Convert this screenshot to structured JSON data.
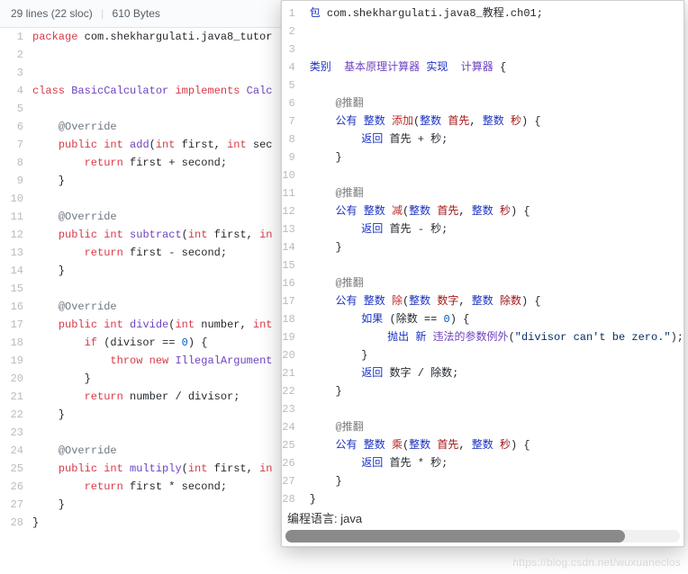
{
  "header": {
    "lines_label": "29 lines (22 sloc)",
    "bytes_label": "610 Bytes"
  },
  "left_code": [
    {
      "n": "1",
      "html": "<span class='kw1'>package</span> com.shekhargulati.java8_tutor"
    },
    {
      "n": "2",
      "html": ""
    },
    {
      "n": "3",
      "html": ""
    },
    {
      "n": "4",
      "html": "<span class='kw1'>class</span> <span class='type'>BasicCalculator</span> <span class='kw1'>implements</span> <span class='type'>Calc</span>"
    },
    {
      "n": "5",
      "html": ""
    },
    {
      "n": "6",
      "html": "    <span class='ovr-left'>@Override</span>"
    },
    {
      "n": "7",
      "html": "    <span class='kw1'>public</span> <span class='kw1'>int</span> <span class='type'>add</span>(<span class='kw1'>int</span> first, <span class='kw1'>int</span> sec"
    },
    {
      "n": "8",
      "html": "        <span class='kw1'>return</span> first + second;"
    },
    {
      "n": "9",
      "html": "    }"
    },
    {
      "n": "10",
      "html": ""
    },
    {
      "n": "11",
      "html": "    <span class='ovr-left'>@Override</span>"
    },
    {
      "n": "12",
      "html": "    <span class='kw1'>public</span> <span class='kw1'>int</span> <span class='type'>subtract</span>(<span class='kw1'>int</span> first, <span class='kw1'>in</span>"
    },
    {
      "n": "13",
      "html": "        <span class='kw1'>return</span> first - second;"
    },
    {
      "n": "14",
      "html": "    }"
    },
    {
      "n": "15",
      "html": ""
    },
    {
      "n": "16",
      "html": "    <span class='ovr-left'>@Override</span>"
    },
    {
      "n": "17",
      "html": "    <span class='kw1'>public</span> <span class='kw1'>int</span> <span class='type'>divide</span>(<span class='kw1'>int</span> number, <span class='kw1'>int</span>"
    },
    {
      "n": "18",
      "html": "        <span class='kw1'>if</span> (divisor == <span class='num'>0</span>) {"
    },
    {
      "n": "19",
      "html": "            <span class='kw1'>throw</span> <span class='kw1'>new</span> <span class='type'>IllegalArgument</span>"
    },
    {
      "n": "20",
      "html": "        }"
    },
    {
      "n": "21",
      "html": "        <span class='kw1'>return</span> number / divisor;"
    },
    {
      "n": "22",
      "html": "    }"
    },
    {
      "n": "23",
      "html": ""
    },
    {
      "n": "24",
      "html": "    <span class='ovr-left'>@Override</span>"
    },
    {
      "n": "25",
      "html": "    <span class='kw1'>public</span> <span class='kw1'>int</span> <span class='type'>multiply</span>(<span class='kw1'>int</span> first, <span class='kw1'>in</span>"
    },
    {
      "n": "26",
      "html": "        <span class='kw1'>return</span> first * second;"
    },
    {
      "n": "27",
      "html": "    }"
    },
    {
      "n": "28",
      "html": "}"
    }
  ],
  "right_code": [
    {
      "n": "1",
      "html": "<span class='kw1'>包</span> com.shekhargulati.java8_教程.ch01;"
    },
    {
      "n": "2",
      "html": ""
    },
    {
      "n": "3",
      "html": ""
    },
    {
      "n": "4",
      "html": "<span class='kw1'>类别</span>  <span class='type2'>基本原理计算器</span> <span class='kw1'>实现</span>  <span class='type2'>计算器</span> {"
    },
    {
      "n": "5",
      "html": ""
    },
    {
      "n": "6",
      "html": "    <span class='ann'>@推翻</span>"
    },
    {
      "n": "7",
      "html": "    <span class='kw1'>公有</span> <span class='kw1'>整数</span> <span class='name'>添加</span>(<span class='kw1'>整数</span> <span class='param'>首先</span>, <span class='kw1'>整数</span> <span class='param'>秒</span>) {"
    },
    {
      "n": "8",
      "html": "        <span class='kw1'>返回</span> 首先 + 秒;"
    },
    {
      "n": "9",
      "html": "    }"
    },
    {
      "n": "10",
      "html": ""
    },
    {
      "n": "11",
      "html": "    <span class='ann'>@推翻</span>"
    },
    {
      "n": "12",
      "html": "    <span class='kw1'>公有</span> <span class='kw1'>整数</span> <span class='name'>减</span>(<span class='kw1'>整数</span> <span class='param'>首先</span>, <span class='kw1'>整数</span> <span class='param'>秒</span>) {"
    },
    {
      "n": "13",
      "html": "        <span class='kw1'>返回</span> 首先 - 秒;"
    },
    {
      "n": "14",
      "html": "    }"
    },
    {
      "n": "15",
      "html": ""
    },
    {
      "n": "16",
      "html": "    <span class='ann'>@推翻</span>"
    },
    {
      "n": "17",
      "html": "    <span class='kw1'>公有</span> <span class='kw1'>整数</span> <span class='name'>除</span>(<span class='kw1'>整数</span> <span class='param'>数字</span>, <span class='kw1'>整数</span> <span class='param'>除数</span>) {"
    },
    {
      "n": "18",
      "html": "        <span class='kw1'>如果</span> (除数 == <span class='num'>0</span>) {"
    },
    {
      "n": "19",
      "html": "            <span class='kw1'>抛出</span> <span class='kw1'>新</span> <span class='type2'>违法的参数例外</span>(<span class='str'>\"divisor can't be zero.\"</span>);"
    },
    {
      "n": "20",
      "html": "        }"
    },
    {
      "n": "21",
      "html": "        <span class='kw1'>返回</span> 数字 / 除数;"
    },
    {
      "n": "22",
      "html": "    }"
    },
    {
      "n": "23",
      "html": ""
    },
    {
      "n": "24",
      "html": "    <span class='ann'>@推翻</span>"
    },
    {
      "n": "25",
      "html": "    <span class='kw1'>公有</span> <span class='kw1'>整数</span> <span class='name'>乘</span>(<span class='kw1'>整数</span> <span class='param'>首先</span>, <span class='kw1'>整数</span> <span class='param'>秒</span>) {"
    },
    {
      "n": "26",
      "html": "        <span class='kw1'>返回</span> 首先 * 秒;"
    },
    {
      "n": "27",
      "html": "    }"
    },
    {
      "n": "28",
      "html": "}"
    }
  ],
  "footer": {
    "lang_label": "编程语言: java"
  },
  "watermark": "https://blog.csdn.net/wuxuaneclos"
}
